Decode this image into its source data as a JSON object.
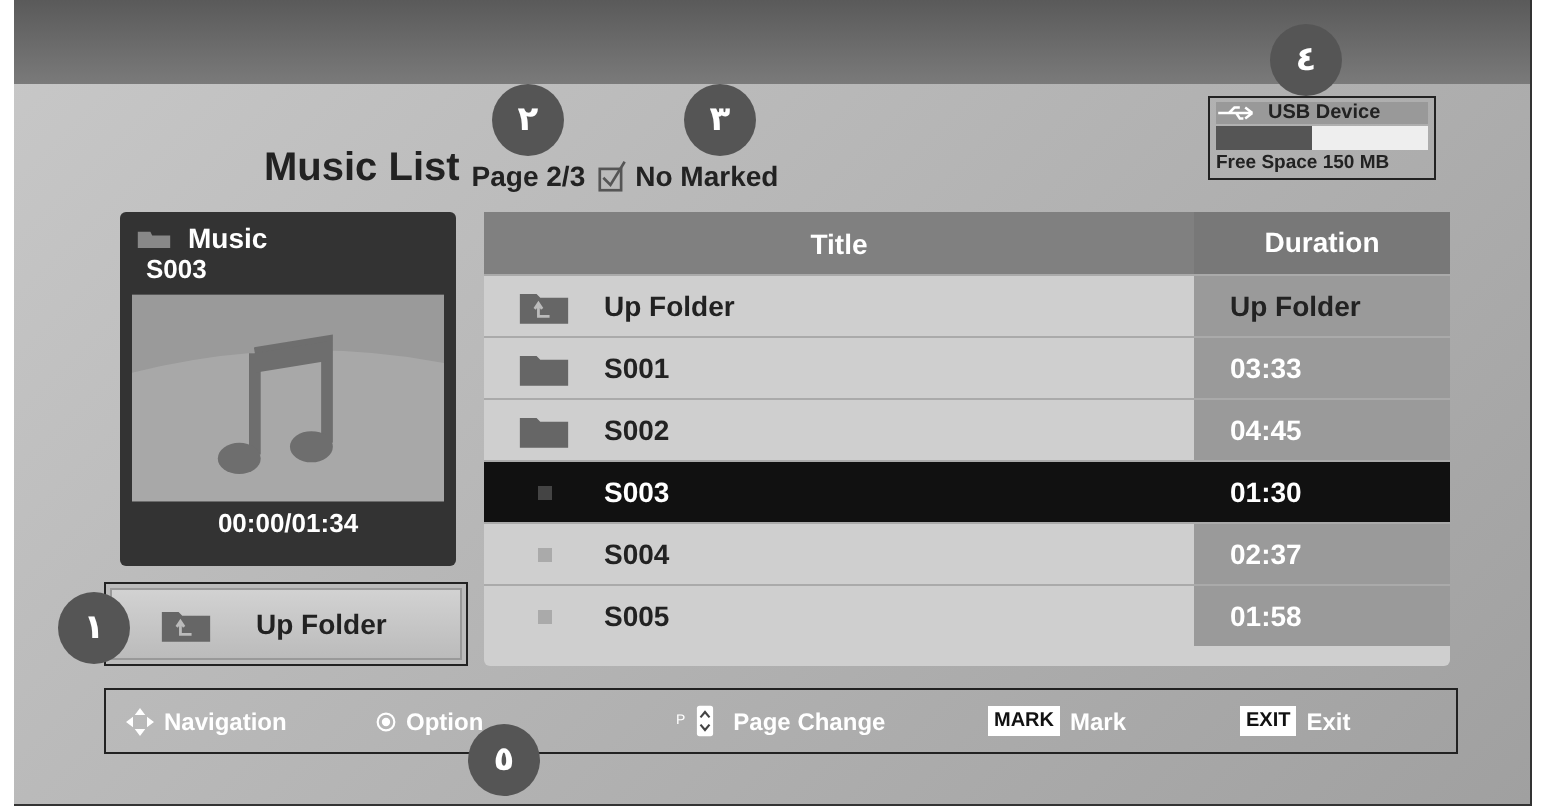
{
  "header": {
    "title": "Music List",
    "page": "Page 2/3",
    "marked": {
      "label": "No Marked",
      "checked": true
    }
  },
  "usb": {
    "label": "USB Device",
    "level": 0.45,
    "free_space": "Free Space 150 MB"
  },
  "now_playing": {
    "category": "Music",
    "track": "S003",
    "time": "00:00/01:34"
  },
  "up_button": {
    "label": "Up Folder"
  },
  "table": {
    "columns": [
      "Title",
      "Duration"
    ],
    "rows": [
      {
        "kind": "up",
        "title": "Up Folder",
        "duration": "Up Folder",
        "selected": false
      },
      {
        "kind": "folder",
        "title": "S001",
        "duration": "03:33",
        "selected": false
      },
      {
        "kind": "folder",
        "title": "S002",
        "duration": "04:45",
        "selected": false
      },
      {
        "kind": "file",
        "title": "S003",
        "duration": "01:30",
        "selected": true
      },
      {
        "kind": "file",
        "title": "S004",
        "duration": "02:37",
        "selected": false
      },
      {
        "kind": "file",
        "title": "S005",
        "duration": "01:58",
        "selected": false
      }
    ]
  },
  "footer": [
    {
      "kind": "nav",
      "label": "Navigation"
    },
    {
      "kind": "option",
      "label": "Option"
    },
    {
      "kind": "page",
      "key": "P",
      "label": "Page Change"
    },
    {
      "kind": "mark",
      "key": "MARK",
      "label": "Mark"
    },
    {
      "kind": "exit",
      "key": "EXIT",
      "label": "Exit"
    }
  ],
  "callouts": [
    "١",
    "٢",
    "٣",
    "٤",
    "٥"
  ]
}
